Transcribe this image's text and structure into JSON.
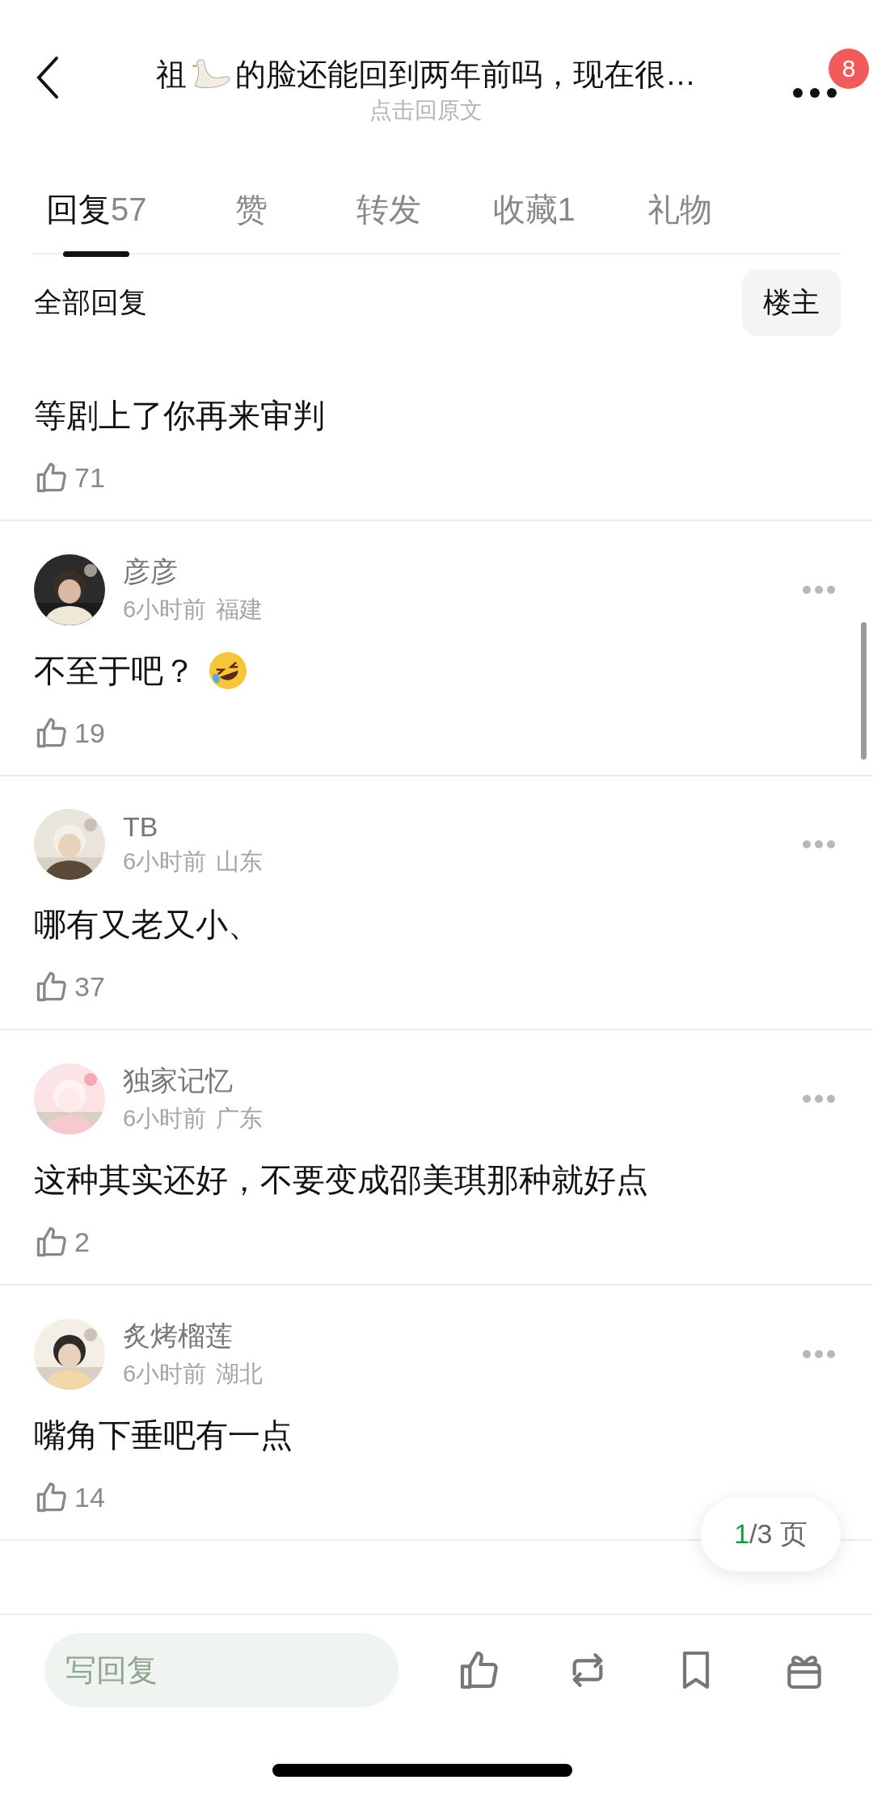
{
  "header": {
    "title_before": "祖",
    "title_after": "的脸还能回到两年前吗，现在很…",
    "subtitle": "点击回原文",
    "badge": "8"
  },
  "tabs": [
    {
      "label": "回复",
      "count": "57",
      "selected": true
    },
    {
      "label": "赞",
      "selected": false
    },
    {
      "label": "转发",
      "selected": false
    },
    {
      "label": "收藏",
      "count": "1",
      "selected": false
    },
    {
      "label": "礼物",
      "selected": false
    }
  ],
  "section": {
    "title": "全部回复",
    "filter": "楼主"
  },
  "comments": [
    {
      "text": "等剧上了你再来审判",
      "has_emoji": false,
      "likes": "71"
    },
    {
      "name": "彦彦",
      "time": "6小时前",
      "location": "福建",
      "text": "不至于吧？",
      "has_emoji": true,
      "likes": "19"
    },
    {
      "name": "TB",
      "time": "6小时前",
      "location": "山东",
      "text": "哪有又老又小、",
      "has_emoji": false,
      "likes": "37"
    },
    {
      "name": "独家记忆",
      "time": "6小时前",
      "location": "广东",
      "text": "这种其实还好，不要变成邵美琪那种就好点",
      "has_emoji": false,
      "likes": "2"
    },
    {
      "name": "炙烤榴莲",
      "time": "6小时前",
      "location": "湖北",
      "text": "嘴角下垂吧有一点",
      "has_emoji": false,
      "likes": "14"
    }
  ],
  "page_indicator": {
    "current": "1",
    "rest": "/3 页"
  },
  "reply_field": {
    "placeholder": "写回复"
  }
}
